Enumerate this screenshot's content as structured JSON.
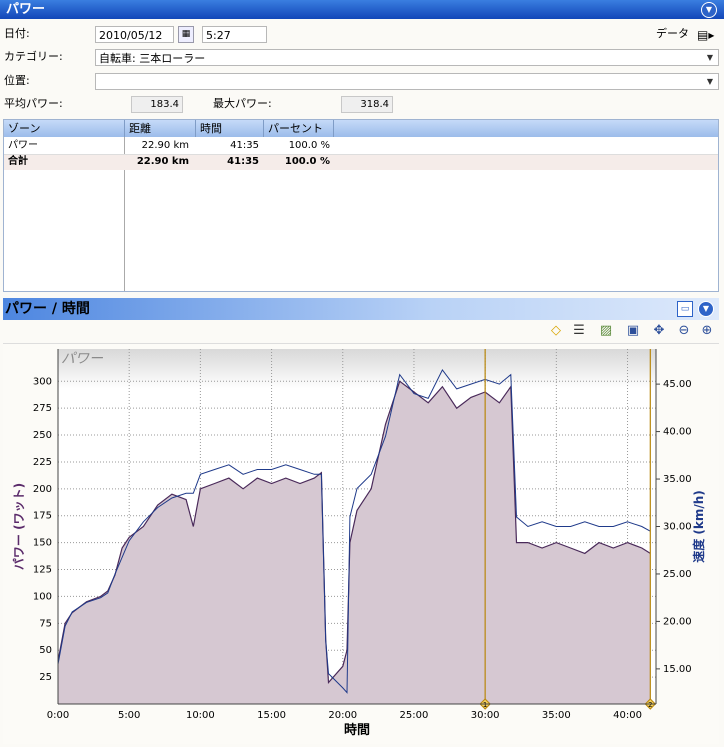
{
  "header": {
    "title": "パワー"
  },
  "form": {
    "date_label": "日付:",
    "date_value": "2010/05/12",
    "time_value": "5:27",
    "data_label": "データ",
    "category_label": "カテゴリー:",
    "category_value": "自転車: 三本ローラー",
    "location_label": "位置:",
    "location_value": "",
    "avg_power_label": "平均パワー:",
    "avg_power_value": "183.4",
    "max_power_label": "最大パワー:",
    "max_power_value": "318.4"
  },
  "zones_table": {
    "columns": [
      "ゾーン",
      "距離",
      "時間",
      "パーセント"
    ],
    "rows": [
      [
        "パワー",
        "22.90 km",
        "41:35",
        "100.0 %"
      ]
    ],
    "total": [
      "合計",
      "22.90 km",
      "41:35",
      "100.0 %"
    ]
  },
  "chart_panel": {
    "title": "パワー / 時間"
  },
  "icons": [
    "collapse-icon",
    "marker-icon",
    "list-view-icon",
    "chart-view-icon",
    "save-icon",
    "settings-icon",
    "zoom-out-icon",
    "zoom-in-icon",
    "calendar-icon",
    "data-icon"
  ],
  "chart_data": {
    "type": "area",
    "title": "パワー",
    "xlabel": "時間",
    "ylabel": "パワー (ワット)",
    "y2label": "速度 (km/h)",
    "xticks": [
      "0:00",
      "5:00",
      "10:00",
      "15:00",
      "20:00",
      "25:00",
      "30:00",
      "35:00",
      "40:00"
    ],
    "yticks": [
      "25",
      "50",
      "75",
      "100",
      "125",
      "150",
      "175",
      "200",
      "225",
      "250",
      "275",
      "300"
    ],
    "y2ticks": [
      "15.00",
      "20.00",
      "25.00",
      "30.00",
      "35.00",
      "40.00",
      "45.00"
    ],
    "xlim": [
      0,
      42
    ],
    "ylim": [
      0,
      330
    ],
    "y2lim": [
      11.3,
      48.7
    ],
    "grid": true,
    "markers": [
      {
        "label": "1",
        "x": 30.0
      },
      {
        "label": "2",
        "x": 41.6
      }
    ],
    "colors": {
      "power_fill": "#d6c8d2",
      "power_line": "#4a2a5a",
      "speed_line": "#1f3a8a",
      "marker": "#b8860b"
    },
    "series": [
      {
        "name": "パワー",
        "x": [
          0,
          0.5,
          1,
          2,
          3,
          3.5,
          4,
          4.5,
          5,
          6,
          7,
          8,
          9,
          9.5,
          10,
          11,
          12,
          13,
          14,
          15,
          16,
          17,
          18,
          18.5,
          18.8,
          19,
          20,
          20.3,
          20.5,
          21,
          22,
          23,
          24,
          25,
          26,
          27,
          28,
          29,
          30,
          31,
          31.8,
          32.2,
          33,
          34,
          35,
          36,
          37,
          38,
          39,
          40,
          41,
          41.6
        ],
        "values": [
          40,
          75,
          85,
          95,
          100,
          105,
          120,
          145,
          155,
          165,
          185,
          195,
          190,
          165,
          200,
          205,
          210,
          200,
          210,
          205,
          210,
          205,
          210,
          215,
          60,
          20,
          35,
          50,
          150,
          180,
          200,
          260,
          300,
          290,
          280,
          295,
          275,
          285,
          290,
          280,
          295,
          150,
          150,
          145,
          150,
          145,
          140,
          150,
          145,
          150,
          145,
          140
        ]
      },
      {
        "name": "速度",
        "x": [
          0,
          0.5,
          1,
          2,
          3,
          3.5,
          4,
          5,
          6,
          7,
          8,
          9,
          9.5,
          10,
          11,
          12,
          13,
          14,
          15,
          16,
          17,
          18,
          18.5,
          18.8,
          19,
          20,
          20.3,
          20.5,
          21,
          22,
          23,
          24,
          25,
          26,
          27,
          28,
          29,
          30,
          31,
          31.8,
          32.2,
          33,
          34,
          35,
          36,
          37,
          38,
          39,
          40,
          41,
          41.6
        ],
        "values": [
          15.5,
          19.5,
          21,
          22,
          22.5,
          23,
          25,
          28.5,
          30.5,
          32,
          33,
          33.5,
          33.5,
          35.5,
          36,
          36.5,
          35.5,
          36,
          36,
          36.5,
          36,
          35.5,
          35.5,
          18,
          14.5,
          13,
          12.5,
          31,
          34,
          35.5,
          39.5,
          46,
          44,
          43.5,
          46.5,
          44.5,
          45,
          45.5,
          45,
          46,
          31,
          30,
          30.5,
          30,
          30,
          30.5,
          30,
          30,
          30.5,
          30,
          29.5
        ]
      }
    ]
  }
}
